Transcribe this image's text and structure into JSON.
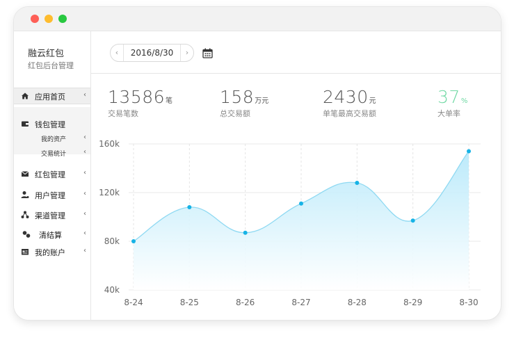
{
  "window": {
    "controls": [
      "close",
      "minimize",
      "zoom"
    ]
  },
  "sidebar": {
    "brand_name": "融云红包",
    "brand_sub": "红包后台管理",
    "items": [
      {
        "label": "应用首页",
        "icon": "home-icon",
        "active": true
      },
      {
        "label": "钱包管理",
        "icon": "wallet-icon",
        "expanded": true,
        "children": [
          {
            "label": "我的资产"
          },
          {
            "label": "交易统计"
          }
        ]
      },
      {
        "label": "红包管理",
        "icon": "envelope-icon"
      },
      {
        "label": "用户管理",
        "icon": "user-icon"
      },
      {
        "label": "渠道管理",
        "icon": "channel-icon"
      },
      {
        "label": "清结算",
        "icon": "settlement-icon"
      },
      {
        "label": "我的账户",
        "icon": "account-icon"
      }
    ],
    "chevron": "‹"
  },
  "toolbar": {
    "date": "2016/8/30",
    "prev": "‹",
    "next": "›",
    "calendar_icon": "calendar-icon"
  },
  "stats": [
    {
      "value": "13586",
      "unit": "笔",
      "label": "交易笔数"
    },
    {
      "value": "158",
      "unit": "万元",
      "label": "总交易额"
    },
    {
      "value": "2430",
      "unit": "元",
      "label": "单笔最高交易额"
    },
    {
      "value": "37",
      "unit": "%",
      "label": "大单率",
      "color": "#6fd8a3"
    }
  ],
  "chart_data": {
    "type": "area",
    "categories": [
      "8-24",
      "8-25",
      "8-26",
      "8-27",
      "8-28",
      "8-29",
      "8-30"
    ],
    "values": [
      80,
      108,
      87,
      111,
      128,
      97,
      154
    ],
    "ylim": [
      40,
      160
    ],
    "yticks": [
      40,
      80,
      120,
      160
    ],
    "ytick_labels": [
      "40k",
      "80k",
      "120k",
      "160k"
    ],
    "grid": true,
    "colors": {
      "line": "#8fd9f2",
      "point": "#17b3e6",
      "fill_top": "#b5e8fa",
      "fill_bottom": "#ffffff"
    }
  }
}
